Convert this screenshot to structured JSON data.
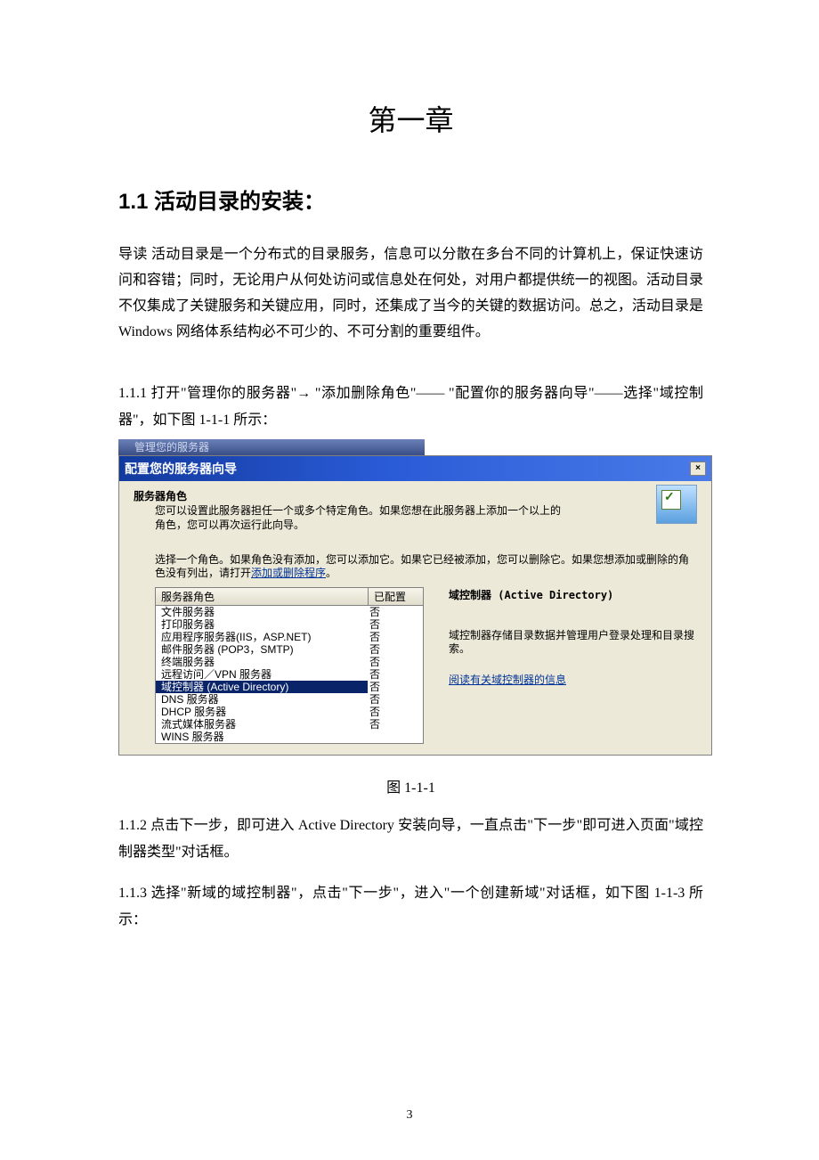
{
  "chapter_title": "第一章",
  "section_title": "1.1   活动目录的安装：",
  "intro": "导读 活动目录是一个分布式的目录服务，信息可以分散在多台不同的计算机上，保证快速访问和容错；同时，无论用户从何处访问或信息处在何处，对用户都提供统一的视图。活动目录不仅集成了关键服务和关键应用，同时，还集成了当今的关键的数据访问。总之，活动目录是 Windows 网络体系结构必不可少的、不可分割的重要组件。",
  "step_111": "1.1.1 打开\"管理你的服务器\"→ \"添加删除角色\"—— \"配置你的服务器向导\"——选择\"域控制器\"，如下图 1-1-1 所示：",
  "screenshot": {
    "outer_title": "管理您的服务器",
    "wizard_title": "配置您的服务器向导",
    "close_label": "×",
    "role_heading": "服务器角色",
    "role_desc": "您可以设置此服务器担任一个或多个特定角色。如果您想在此服务器上添加一个以上的角色，您可以再次运行此向导。",
    "select_text_prefix": "选择一个角色。如果角色没有添加，您可以添加它。如果它已经被添加，您可以删除它。如果您想添加或删除的角色没有列出，请打开",
    "select_link": "添加或删除程序",
    "select_text_suffix": "。",
    "table": {
      "col_role": "服务器角色",
      "col_conf": "已配置",
      "rows": [
        {
          "name": "文件服务器",
          "conf": "否",
          "selected": false
        },
        {
          "name": "打印服务器",
          "conf": "否",
          "selected": false
        },
        {
          "name": "应用程序服务器(IIS，ASP.NET)",
          "conf": "否",
          "selected": false
        },
        {
          "name": "邮件服务器 (POP3，SMTP)",
          "conf": "否",
          "selected": false
        },
        {
          "name": "终端服务器",
          "conf": "否",
          "selected": false
        },
        {
          "name": "远程访问／VPN 服务器",
          "conf": "否",
          "selected": false
        },
        {
          "name": "域控制器 (Active Directory)",
          "conf": "否",
          "selected": true
        },
        {
          "name": "DNS 服务器",
          "conf": "否",
          "selected": false
        },
        {
          "name": "DHCP 服务器",
          "conf": "否",
          "selected": false
        },
        {
          "name": "流式媒体服务器",
          "conf": "否",
          "selected": false
        },
        {
          "name": "WINS 服务器",
          "conf": "",
          "selected": false
        }
      ]
    },
    "side": {
      "header": "域控制器 (Active Directory)",
      "desc": "域控制器存储目录数据并管理用户登录处理和目录搜索。",
      "more_link": "阅读有关域控制器的信息"
    }
  },
  "caption": "图 1-1-1",
  "step_112": "1.1.2 点击下一步，即可进入 Active Directory 安装向导，一直点击\"下一步\"即可进入页面\"域控制器类型\"对话框。",
  "step_113": "1.1.3 选择\"新域的域控制器\"，点击\"下一步\"，进入\"一个创建新域\"对话框，如下图 1-1-3 所示：",
  "page_number": "3"
}
